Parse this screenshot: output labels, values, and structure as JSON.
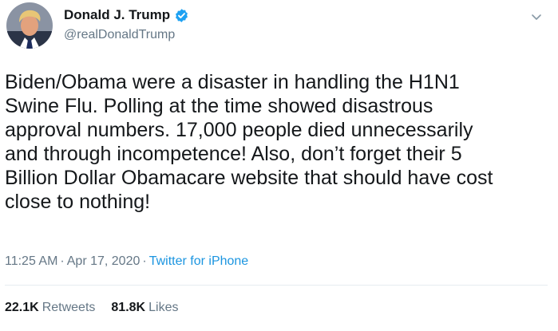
{
  "author": {
    "display_name": "Donald J. Trump",
    "handle": "@realDonaldTrump",
    "verified": true,
    "avatar": "profile-photo"
  },
  "tweet": {
    "text": "Biden/Obama were a disaster in handling the H1N1\nSwine Flu. Polling at the time showed disastrous\napproval numbers. 17,000 people died unnecessarily\nand through incompetence! Also, don’t forget their 5\nBillion Dollar Obamacare website that should have cost\nclose to nothing!",
    "time": "11:25 AM",
    "date": "Apr 17, 2020",
    "source": "Twitter for iPhone"
  },
  "stats": {
    "retweets_count": "22.1K",
    "retweets_label": "Retweets",
    "likes_count": "81.8K",
    "likes_label": "Likes"
  },
  "icons": {
    "verified": "verified-badge-icon",
    "menu": "chevron-down-icon"
  },
  "colors": {
    "text": "#14171a",
    "secondary": "#657786",
    "link": "#1b95e0",
    "verified": "#1da1f2",
    "divider": "#e6ecf0"
  }
}
